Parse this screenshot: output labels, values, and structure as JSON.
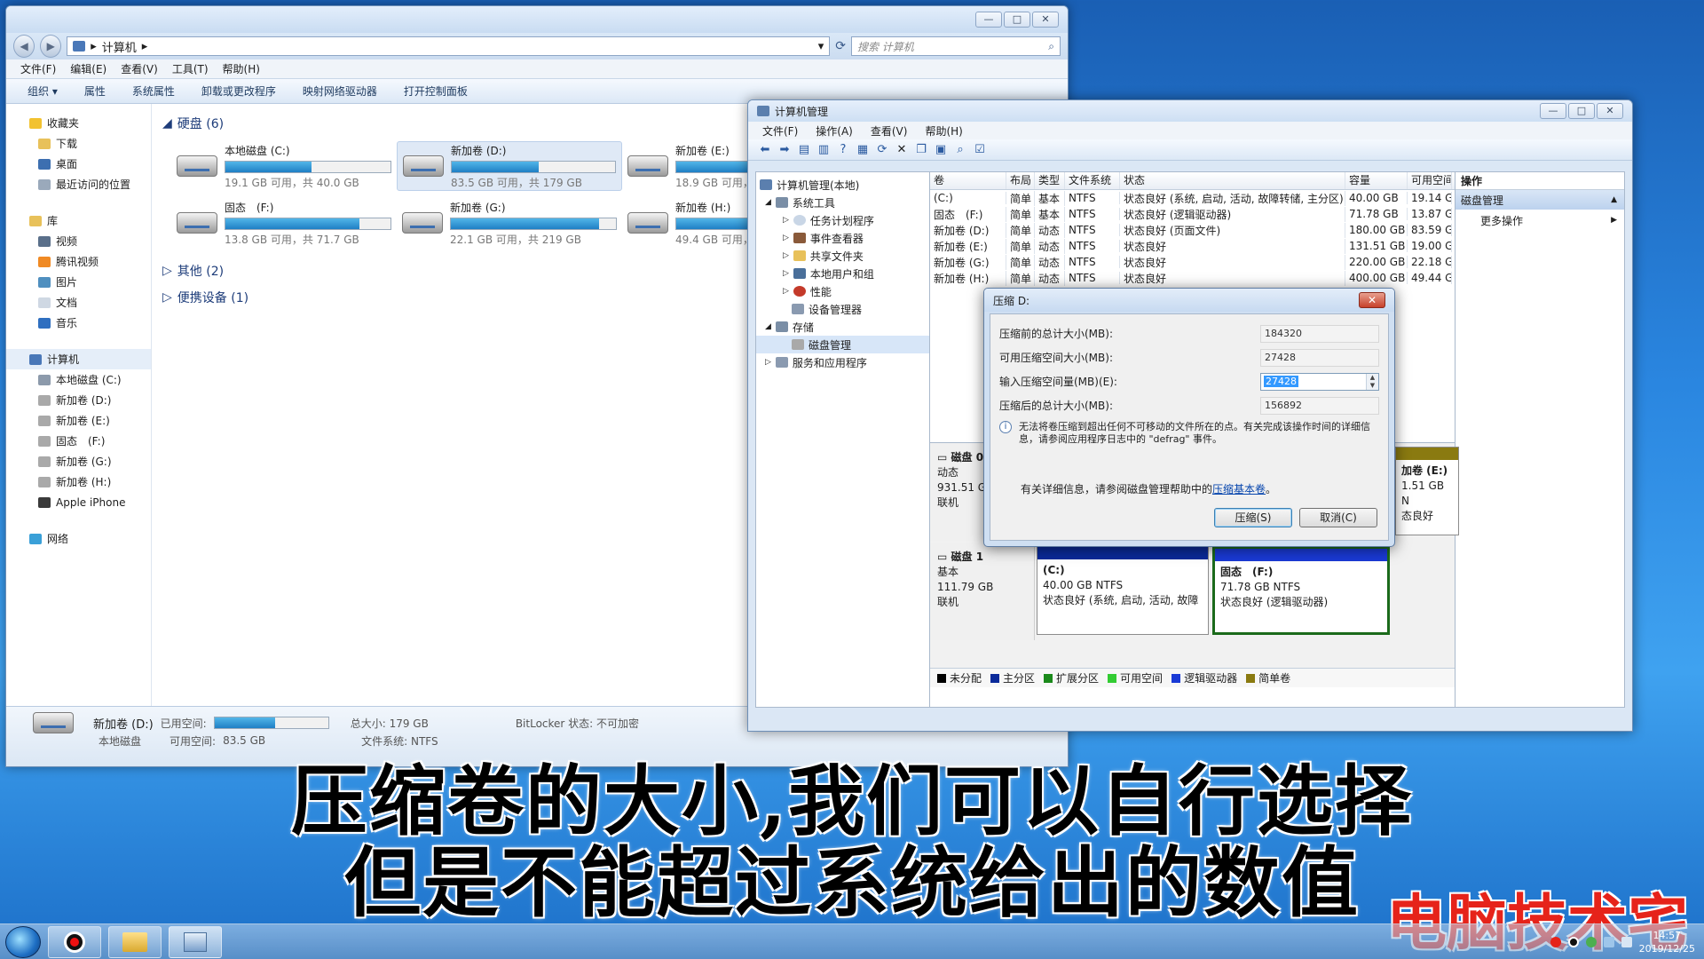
{
  "explorer": {
    "window_buttons": [
      "—",
      "□",
      "✕"
    ],
    "breadcrumb": [
      "计算机"
    ],
    "search_placeholder": "搜索 计算机",
    "menu": [
      "文件(F)",
      "编辑(E)",
      "查看(V)",
      "工具(T)",
      "帮助(H)"
    ],
    "toolbar": [
      "组织 ▾",
      "属性",
      "系统属性",
      "卸载或更改程序",
      "映射网络驱动器",
      "打开控制面板"
    ],
    "sidebar": {
      "favorites": {
        "label": "收藏夹",
        "items": [
          "下载",
          "桌面",
          "最近访问的位置"
        ]
      },
      "libraries": {
        "label": "库",
        "items": [
          "视频",
          "腾讯视频",
          "图片",
          "文档",
          "音乐"
        ]
      },
      "computer": {
        "label": "计算机",
        "items": [
          "本地磁盘 (C:)",
          "新加卷 (D:)",
          "新加卷 (E:)",
          "固态　(F:)",
          "新加卷 (G:)",
          "新加卷 (H:)",
          "Apple iPhone"
        ]
      },
      "network": {
        "label": "网络"
      }
    },
    "groups": {
      "hard_disks": "硬盘 (6)",
      "other": "其他 (2)",
      "portable": "便携设备 (1)"
    },
    "drives": [
      {
        "name": "本地磁盘 (C:)",
        "free": "19.1 GB 可用，共 40.0 GB",
        "used": 0.52
      },
      {
        "name": "新加卷 (D:)",
        "free": "83.5 GB 可用，共 179 GB",
        "used": 0.53
      },
      {
        "name": "新加卷 (E:)",
        "free": "18.9 GB 可用，",
        "used": 0.86
      },
      {
        "name": "固态　(F:)",
        "free": "13.8 GB 可用，共 71.7 GB",
        "used": 0.81
      },
      {
        "name": "新加卷 (G:)",
        "free": "22.1 GB 可用，共 219 GB",
        "used": 0.9
      },
      {
        "name": "新加卷 (H:)",
        "free": "49.4 GB 可用，",
        "used": 0.88
      }
    ],
    "status": {
      "name": "新加卷 (D:)",
      "used_label": "已用空间:",
      "type": "本地磁盘",
      "free_label": "可用空间:",
      "free_value": "83.5 GB",
      "total": "总大小: 179 GB",
      "fs": "文件系统: NTFS",
      "bitlocker": "BitLocker 状态: 不可加密",
      "used": 0.53
    }
  },
  "mmc": {
    "title": "计算机管理",
    "window_buttons": [
      "—",
      "□",
      "✕"
    ],
    "menu": [
      "文件(F)",
      "操作(A)",
      "查看(V)",
      "帮助(H)"
    ],
    "tree": [
      {
        "label": "计算机管理(本地)",
        "indent": 0,
        "arrow": ""
      },
      {
        "label": "系统工具",
        "indent": 1,
        "arrow": "◢"
      },
      {
        "label": "任务计划程序",
        "indent": 2,
        "arrow": "▷"
      },
      {
        "label": "事件查看器",
        "indent": 2,
        "arrow": "▷"
      },
      {
        "label": "共享文件夹",
        "indent": 2,
        "arrow": "▷"
      },
      {
        "label": "本地用户和组",
        "indent": 2,
        "arrow": "▷"
      },
      {
        "label": "性能",
        "indent": 2,
        "arrow": "▷"
      },
      {
        "label": "设备管理器",
        "indent": 2,
        "arrow": ""
      },
      {
        "label": "存储",
        "indent": 1,
        "arrow": "◢"
      },
      {
        "label": "磁盘管理",
        "indent": 2,
        "arrow": ""
      },
      {
        "label": "服务和应用程序",
        "indent": 1,
        "arrow": "▷"
      }
    ],
    "volume_columns": [
      "卷",
      "布局",
      "类型",
      "文件系统",
      "状态",
      "容量",
      "可用空间"
    ],
    "volumes": [
      [
        "(C:)",
        "简单",
        "基本",
        "NTFS",
        "状态良好 (系统, 启动, 活动, 故障转储, 主分区)",
        "40.00 GB",
        "19.14 G"
      ],
      [
        "固态　(F:)",
        "简单",
        "基本",
        "NTFS",
        "状态良好 (逻辑驱动器)",
        "71.78 GB",
        "13.87 G"
      ],
      [
        "新加卷 (D:)",
        "简单",
        "动态",
        "NTFS",
        "状态良好 (页面文件)",
        "180.00 GB",
        "83.59 G"
      ],
      [
        "新加卷 (E:)",
        "简单",
        "动态",
        "NTFS",
        "状态良好",
        "131.51 GB",
        "19.00 G"
      ],
      [
        "新加卷 (G:)",
        "简单",
        "动态",
        "NTFS",
        "状态良好",
        "220.00 GB",
        "22.18 G"
      ],
      [
        "新加卷 (H:)",
        "简单",
        "动态",
        "NTFS",
        "状态良好",
        "400.00 GB",
        "49.44 G"
      ]
    ],
    "actions": {
      "header": "操作",
      "group": "磁盘管理",
      "more": "更多操作"
    },
    "disk0": {
      "name": "磁盘 0",
      "type": "动态",
      "size": "931.51 GB",
      "status": "联机",
      "right_label": "加卷 (E:)",
      "right_size": "1.51 GB N",
      "right_status": "态良好"
    },
    "disk1": {
      "name": "磁盘 1",
      "type": "基本",
      "size": "111.79 GB",
      "status": "联机",
      "partitions": [
        {
          "title": "(C:)",
          "size": "40.00 GB NTFS",
          "status": "状态良好 (系统, 启动, 活动, 故障"
        },
        {
          "title": "固态　(F:)",
          "size": "71.78 GB NTFS",
          "status": "状态良好 (逻辑驱动器)"
        }
      ]
    },
    "legend": [
      {
        "label": "未分配",
        "color": "#000000"
      },
      {
        "label": "主分区",
        "color": "#0a2a9a"
      },
      {
        "label": "扩展分区",
        "color": "#1b8a1b"
      },
      {
        "label": "可用空间",
        "color": "#33cc33"
      },
      {
        "label": "逻辑驱动器",
        "color": "#1a3ad6"
      },
      {
        "label": "简单卷",
        "color": "#8a7a10"
      }
    ]
  },
  "dialog": {
    "title": "压缩 D:",
    "close": "✕",
    "rows": [
      {
        "label": "压缩前的总计大小(MB):",
        "value": "184320"
      },
      {
        "label": "可用压缩空间大小(MB):",
        "value": "27428"
      },
      {
        "label": "输入压缩空间量(MB)(E):",
        "value": "27428"
      },
      {
        "label": "压缩后的总计大小(MB):",
        "value": "156892"
      }
    ],
    "note": "无法将卷压缩到超出任何不可移动的文件所在的点。有关完成该操作时间的详细信息，请参阅应用程序日志中的 \"defrag\" 事件。",
    "help_prefix": "有关详细信息，请参阅磁盘管理帮助中的",
    "help_link": "压缩基本卷",
    "help_suffix": "。",
    "ok": "压缩(S)",
    "cancel": "取消(C)"
  },
  "captions": {
    "line1": "压缩卷的大小,我们可以自行选择",
    "line2": "但是不能超过系统给出的数值"
  },
  "watermark": "电脑技术宅",
  "taskbar": {
    "time": "14:57",
    "date": "2019/12/25"
  },
  "colors": {
    "accent": "#1f7fc4",
    "caption_red": "#e6231a"
  }
}
